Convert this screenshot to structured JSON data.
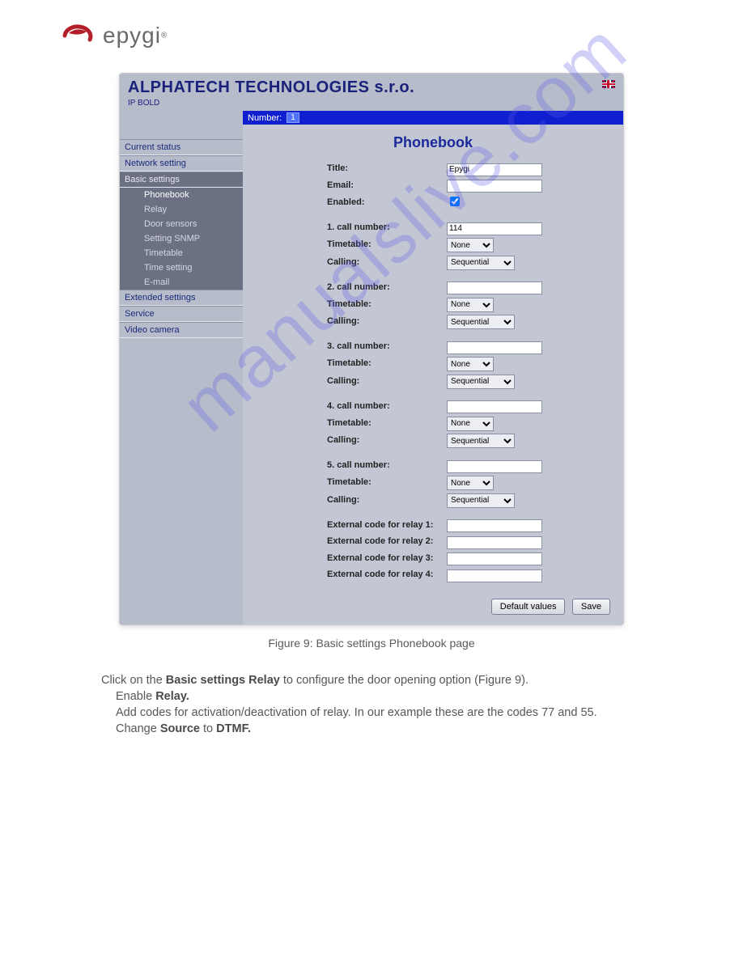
{
  "logo": {
    "text": "epygi",
    "reg": "®"
  },
  "watermark": "manualslive.com",
  "app": {
    "title": "ALPHATECH TECHNOLOGIES s.r.o.",
    "subtitle": "IP BOLD",
    "numbar_label": "Number:",
    "numbar_value": "1"
  },
  "sidebar": {
    "items": [
      {
        "label": "Current status"
      },
      {
        "label": "Network setting"
      },
      {
        "label": "Basic settings",
        "sub": [
          {
            "label": "Phonebook",
            "active": true
          },
          {
            "label": "Relay"
          },
          {
            "label": "Door sensors"
          },
          {
            "label": "Setting SNMP"
          },
          {
            "label": "Timetable"
          },
          {
            "label": "Time setting"
          },
          {
            "label": "E-mail"
          }
        ]
      },
      {
        "label": "Extended settings"
      },
      {
        "label": "Service"
      },
      {
        "label": "Video camera"
      }
    ]
  },
  "content": {
    "heading": "Phonebook",
    "fields": {
      "title_label": "Title:",
      "title_value": "Epygi",
      "email_label": "Email:",
      "email_value": "",
      "enabled_label": "Enabled:",
      "groups": [
        {
          "num_label": "1. call number:",
          "num_value": "114",
          "tt_label": "Timetable:",
          "tt_value": "None",
          "call_label": "Calling:",
          "call_value": "Sequential"
        },
        {
          "num_label": "2. call number:",
          "num_value": "",
          "tt_label": "Timetable:",
          "tt_value": "None",
          "call_label": "Calling:",
          "call_value": "Sequential"
        },
        {
          "num_label": "3. call number:",
          "num_value": "",
          "tt_label": "Timetable:",
          "tt_value": "None",
          "call_label": "Calling:",
          "call_value": "Sequential"
        },
        {
          "num_label": "4. call number:",
          "num_value": "",
          "tt_label": "Timetable:",
          "tt_value": "None",
          "call_label": "Calling:",
          "call_value": "Sequential"
        },
        {
          "num_label": "5. call number:",
          "num_value": "",
          "tt_label": "Timetable:",
          "tt_value": "None",
          "call_label": "Calling:",
          "call_value": "Sequential"
        }
      ],
      "ext_labels": [
        "External code for relay 1:",
        "External code for relay 2:",
        "External code for relay 3:",
        "External code for relay 4:"
      ]
    },
    "buttons": {
      "default": "Default values",
      "save": "Save"
    }
  },
  "caption": "Figure 9: Basic settings   Phonebook page",
  "doc": {
    "l1a": "Click on the ",
    "l1b": "Basic settings   Relay",
    "l1c": " to configure the door opening option (Figure 9).",
    "l2a": "Enable ",
    "l2b": "Relay.",
    "l3": "Add codes for activation/deactivation of relay. In our example these are the codes 77 and 55.",
    "l4a": "Change ",
    "l4b": "Source",
    "l4c": " to ",
    "l4d": "DTMF."
  }
}
